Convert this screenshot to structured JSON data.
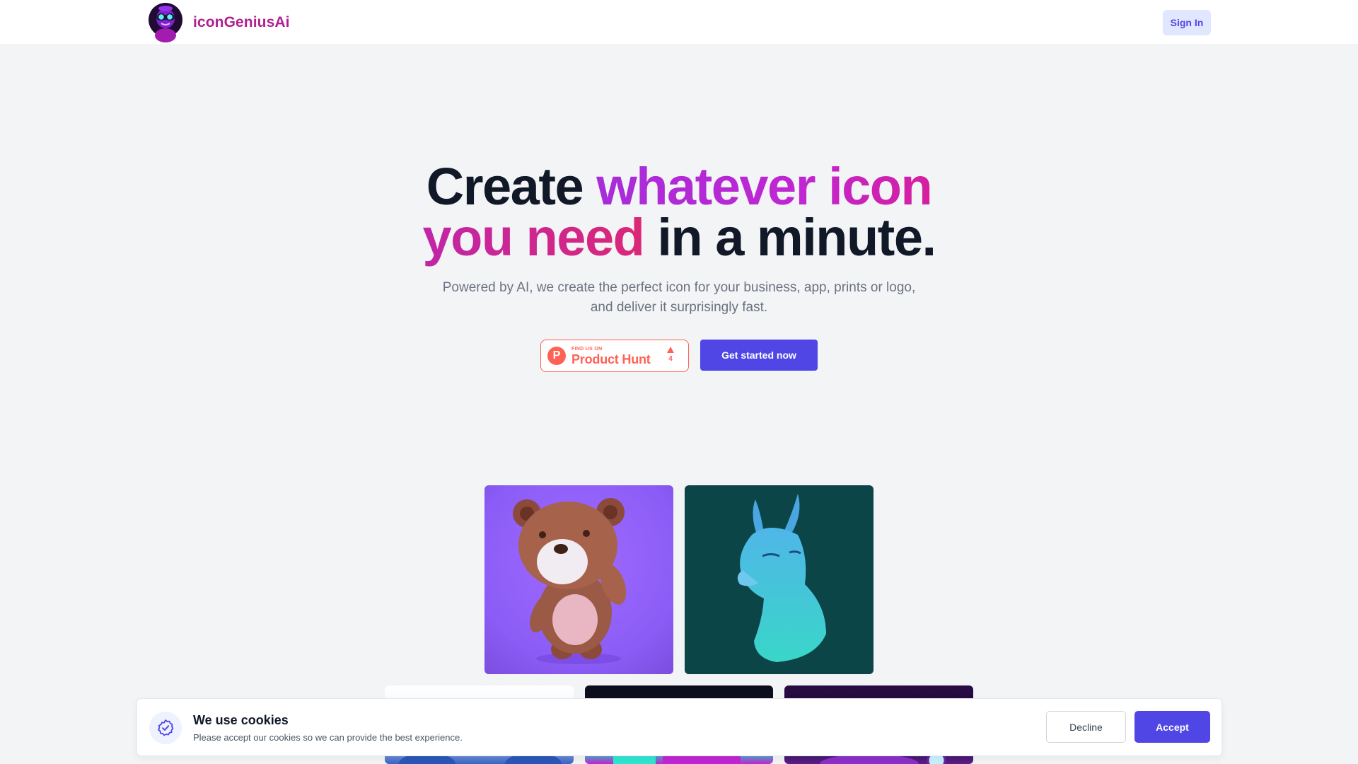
{
  "header": {
    "brand": "iconGeniusAi",
    "signin_label": "Sign In"
  },
  "hero": {
    "title_part1": "Create ",
    "title_part2": "whatever icon",
    "title_part3": "you need",
    "title_part4": " in a minute.",
    "subtitle_line1": "Powered by AI, we create the perfect icon for your business, app, prints or logo,",
    "subtitle_line2": "and deliver it surprisingly fast."
  },
  "product_hunt": {
    "small_label": "FIND US ON",
    "name": "Product Hunt",
    "logo_letter": "P",
    "upvotes": "4"
  },
  "cta_label": "Get started now",
  "gallery": {
    "tiles": [
      {
        "name": "bear-icon",
        "bg": "#8b5cf6"
      },
      {
        "name": "llama-icon",
        "bg": "#0b4547"
      },
      {
        "name": "blue-character-icon",
        "bg": "#ffffff"
      },
      {
        "name": "neon-icon",
        "bg": "#0b0d1c"
      },
      {
        "name": "purple-character-icon",
        "bg": "#2a0b44"
      }
    ]
  },
  "cookie": {
    "title": "We use cookies",
    "text": "Please accept our cookies so we can provide the best experience.",
    "decline_label": "Decline",
    "accept_label": "Accept"
  },
  "colors": {
    "accent": "#4f46e5",
    "brand": "#b1208f",
    "product_hunt": "#ff6154",
    "background": "#f3f4f6"
  }
}
